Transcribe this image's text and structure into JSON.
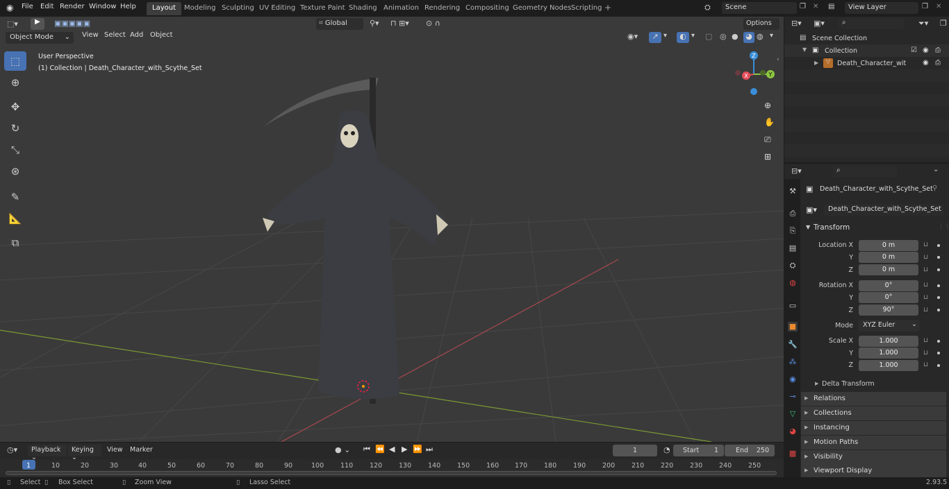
{
  "menus": [
    "File",
    "Edit",
    "Render",
    "Window",
    "Help"
  ],
  "workspace_tabs": [
    "Layout",
    "Modeling",
    "Sculpting",
    "UV Editing",
    "Texture Paint",
    "Shading",
    "Animation",
    "Rendering",
    "Compositing",
    "Geometry Nodes",
    "Scripting"
  ],
  "active_tab": "Layout",
  "scene_name": "Scene",
  "view_layer": "View Layer",
  "viewport": {
    "mode": "Object Mode",
    "menus": [
      "View",
      "Select",
      "Add",
      "Object"
    ],
    "orientation": "Global",
    "options_label": "Options",
    "perspective_label": "User Perspective",
    "collection_label": "(1) Collection | Death_Character_with_Scythe_Set",
    "gizmo_axes": {
      "x": "X",
      "y": "Y",
      "z": "Z"
    }
  },
  "outliner": {
    "scene_collection": "Scene Collection",
    "collection": "Collection",
    "object": "Death_Character_with_Sc"
  },
  "properties": {
    "object_name": "Death_Character_with_Scythe_Set",
    "data_name": "Death_Character_with_Scythe_Set",
    "transform_header": "Transform",
    "location_label": "Location X",
    "rotation_label": "Rotation X",
    "scale_label": "Scale X",
    "y_label": "Y",
    "z_label": "Z",
    "location": [
      "0 m",
      "0 m",
      "0 m"
    ],
    "rotation": [
      "0°",
      "0°",
      "90°"
    ],
    "mode_label": "Mode",
    "mode_value": "XYZ Euler",
    "scale": [
      "1.000",
      "1.000",
      "1.000"
    ],
    "delta_transform": "Delta Transform",
    "panels": [
      "Relations",
      "Collections",
      "Instancing",
      "Motion Paths",
      "Visibility",
      "Viewport Display"
    ]
  },
  "timeline": {
    "menus": [
      "Playback",
      "Keying",
      "View",
      "Marker"
    ],
    "current_frame": "1",
    "start_label": "Start",
    "start": "1",
    "end_label": "End",
    "end": "250",
    "ruler": [
      "1",
      "10",
      "20",
      "30",
      "40",
      "50",
      "60",
      "70",
      "80",
      "90",
      "100",
      "110",
      "120",
      "130",
      "140",
      "150",
      "160",
      "170",
      "180",
      "190",
      "200",
      "210",
      "220",
      "230",
      "240",
      "250"
    ]
  },
  "status": {
    "select": "Select",
    "box_select": "Box Select",
    "zoom_view": "Zoom View",
    "lasso_select": "Lasso Select",
    "version": "2.93.5"
  },
  "colors": {
    "accent": "#4772b3",
    "x_axis": "#e44d5a",
    "y_axis": "#8cc63f",
    "z_axis": "#3b8ed8"
  }
}
